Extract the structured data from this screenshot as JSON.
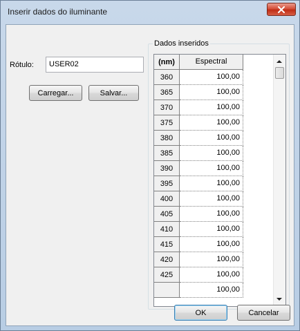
{
  "window": {
    "title": "Inserir dados do iluminante"
  },
  "label": {
    "text": "Rótulo:",
    "value": "USER02"
  },
  "buttons": {
    "load": "Carregar...",
    "save": "Salvar...",
    "ok": "OK",
    "cancel": "Cancelar"
  },
  "group": {
    "title": "Dados inseridos"
  },
  "grid": {
    "headers": [
      "(nm)",
      "Espectral"
    ],
    "rows": [
      [
        "360",
        "100,00"
      ],
      [
        "365",
        "100,00"
      ],
      [
        "370",
        "100,00"
      ],
      [
        "375",
        "100,00"
      ],
      [
        "380",
        "100,00"
      ],
      [
        "385",
        "100,00"
      ],
      [
        "390",
        "100,00"
      ],
      [
        "395",
        "100,00"
      ],
      [
        "400",
        "100,00"
      ],
      [
        "405",
        "100,00"
      ],
      [
        "410",
        "100,00"
      ],
      [
        "415",
        "100,00"
      ],
      [
        "420",
        "100,00"
      ],
      [
        "425",
        "100,00"
      ]
    ],
    "partial_row_value": "100,00"
  },
  "colors": {
    "close_button": "#c8402a",
    "client_bg": "#f0f0f0"
  }
}
